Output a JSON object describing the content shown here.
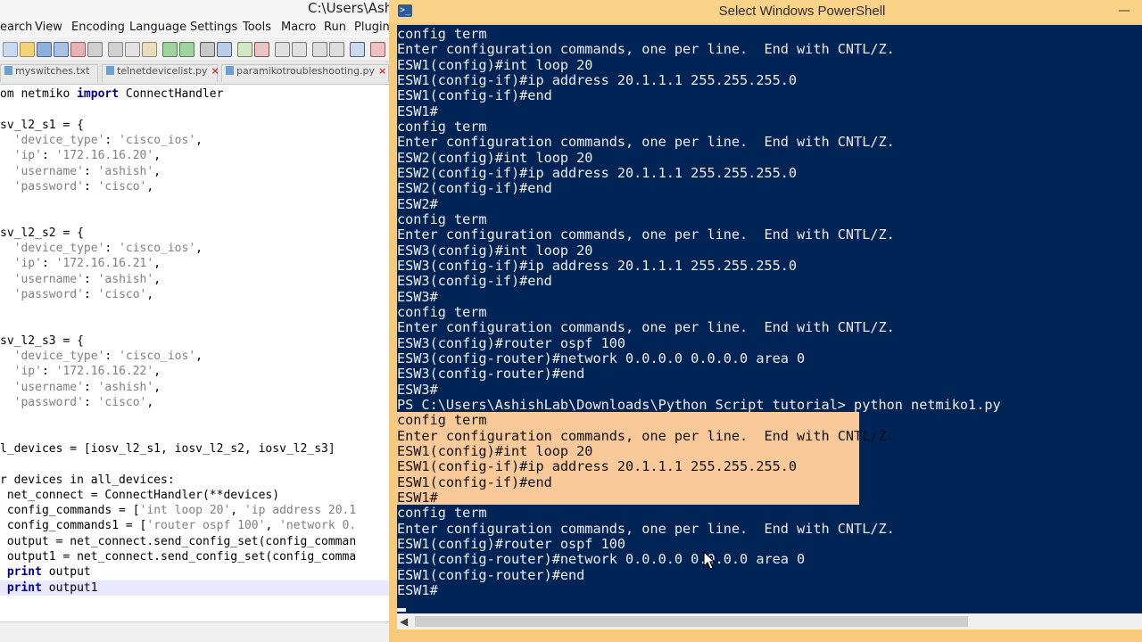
{
  "npp": {
    "title": "C:\\Users\\Ashish",
    "menu": [
      "earch",
      "View",
      "Encoding",
      "Language",
      "Settings",
      "Tools",
      "Macro",
      "Run",
      "Plugins"
    ],
    "tabs": [
      "myswitches.txt",
      "telnetdevicelist.py",
      "paramikotroubleshooting.py"
    ],
    "code": [
      "om netmiko import ConnectHandler",
      "",
      "sv_l2_s1 = {",
      "  'device_type': 'cisco_ios',",
      "  'ip': '172.16.16.20',",
      "  'username': 'ashish',",
      "  'password': 'cisco',",
      "",
      "",
      "sv_l2_s2 = {",
      "  'device_type': 'cisco_ios',",
      "  'ip': '172.16.16.21',",
      "  'username': 'ashish',",
      "  'password': 'cisco',",
      "",
      "",
      "sv_l2_s3 = {",
      "  'device_type': 'cisco_ios',",
      "  'ip': '172.16.16.22',",
      "  'username': 'ashish',",
      "  'password': 'cisco',",
      "",
      "",
      "l_devices = [iosv_l2_s1, iosv_l2_s2, iosv_l2_s3]",
      "",
      "r devices in all_devices:",
      " net_connect = ConnectHandler(**devices)",
      " config_commands = ['int loop 20', 'ip address 20.1",
      " config_commands1 = ['router ospf 100', 'network 0.",
      " output = net_connect.send_config_set(config_comman",
      " output1 = net_connect.send_config_set(config_comma",
      " print output",
      " print output1"
    ]
  },
  "ps": {
    "title": "Select Windows PowerShell",
    "icon_glyph": ">_",
    "minimize_glyph": "—",
    "scroll_left_glyph": "◀",
    "lines": [
      "config term",
      "Enter configuration commands, one per line.  End with CNTL/Z.",
      "ESW1(config)#int loop 20",
      "ESW1(config-if)#ip address 20.1.1.1 255.255.255.0",
      "ESW1(config-if)#end",
      "ESW1#",
      "config term",
      "Enter configuration commands, one per line.  End with CNTL/Z.",
      "ESW2(config)#int loop 20",
      "ESW2(config-if)#ip address 20.1.1.1 255.255.255.0",
      "ESW2(config-if)#end",
      "ESW2#",
      "config term",
      "Enter configuration commands, one per line.  End with CNTL/Z.",
      "ESW3(config)#int loop 20",
      "ESW3(config-if)#ip address 20.1.1.1 255.255.255.0",
      "ESW3(config-if)#end",
      "ESW3#",
      "config term",
      "Enter configuration commands, one per line.  End with CNTL/Z.",
      "ESW3(config)#router ospf 100",
      "ESW3(config-router)#network 0.0.0.0 0.0.0.0 area 0",
      "ESW3(config-router)#end",
      "ESW3#",
      "PS C:\\Users\\AshishLab\\Downloads\\Python Script tutorial> python netmiko1.py",
      "config term",
      "Enter configuration commands, one per line.  End with CNTL/Z.",
      "ESW1(config)#int loop 20",
      "ESW1(config-if)#ip address 20.1.1.1 255.255.255.0",
      "ESW1(config-if)#end",
      "ESW1#",
      "config term",
      "Enter configuration commands, one per line.  End with CNTL/Z.",
      "ESW1(config)#router ospf 100",
      "ESW1(config-router)#network 0.0.0.0 0.0.0.0 area 0",
      "ESW1(config-router)#end",
      "ESW1#"
    ]
  },
  "colors": {
    "ps_background": "#012456",
    "ps_text": "#eeedf0",
    "ps_titlebar": "#fbd388",
    "selection": "#f9c999"
  }
}
